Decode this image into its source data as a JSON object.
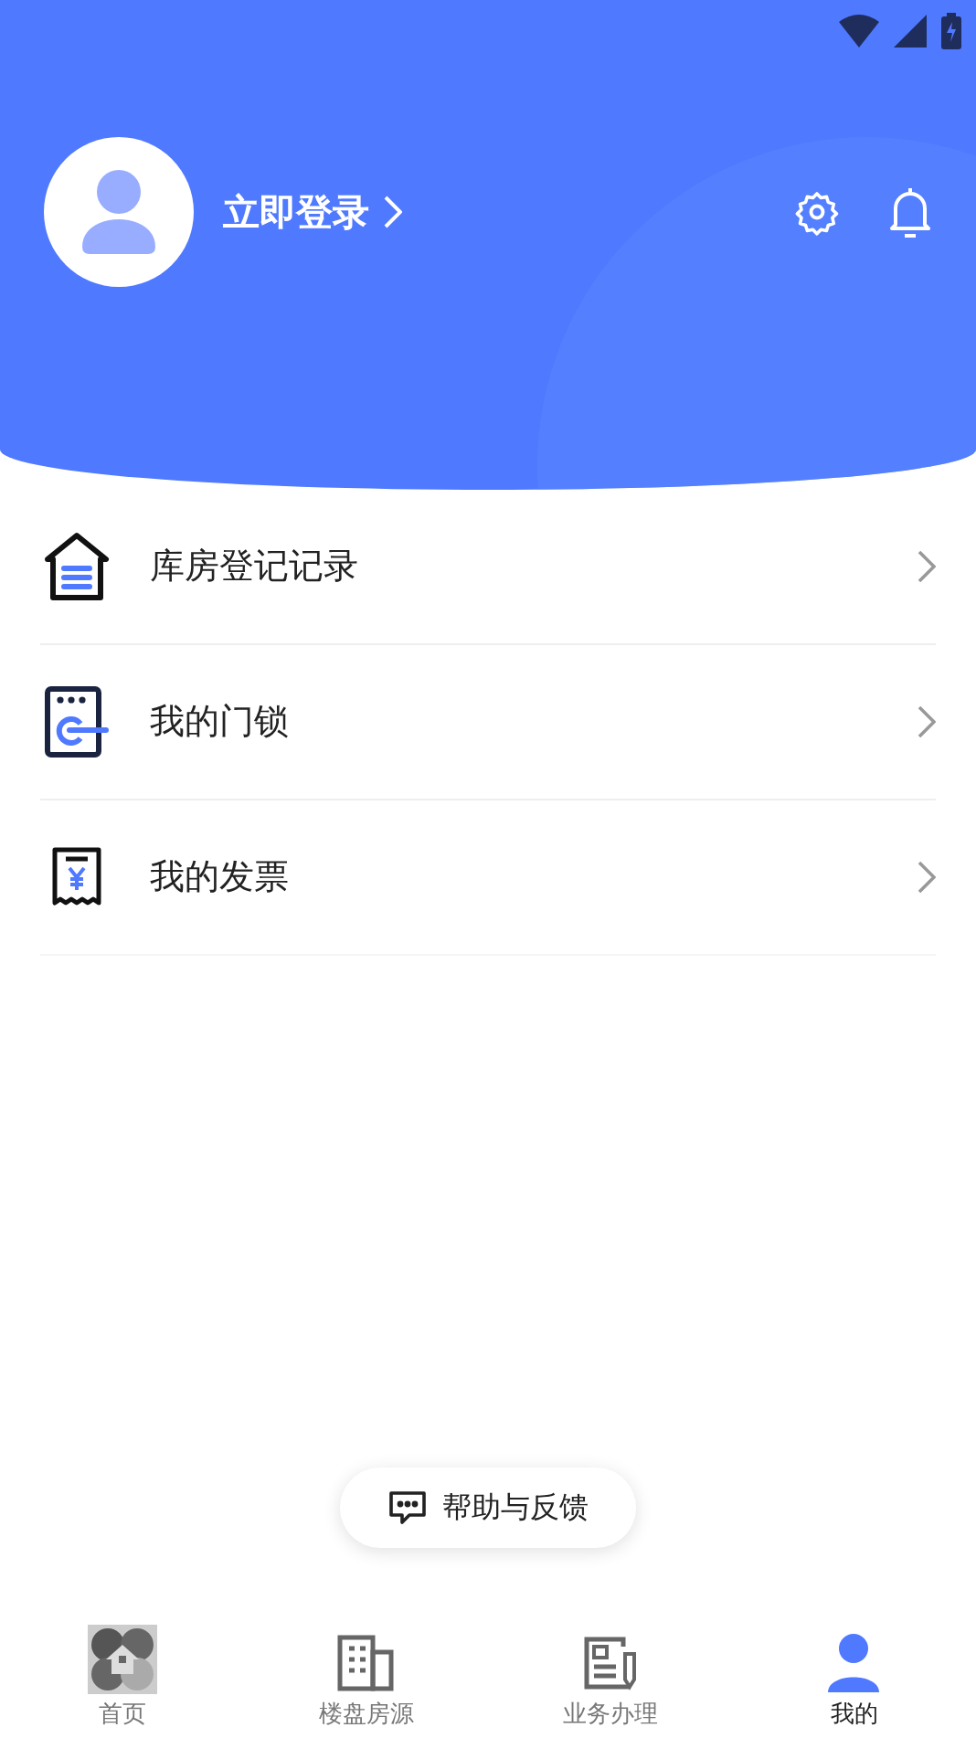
{
  "profile": {
    "login_label": "立即登录"
  },
  "menu": [
    {
      "kind": "warehouse",
      "label": "库房登记记录"
    },
    {
      "kind": "lock",
      "label": "我的门锁"
    },
    {
      "kind": "invoice",
      "label": "我的发票"
    }
  ],
  "help_button": {
    "label": "帮助与反馈"
  },
  "tabs": [
    {
      "kind": "home",
      "label": "首页",
      "selected": false
    },
    {
      "kind": "building",
      "label": "楼盘房源",
      "selected": false
    },
    {
      "kind": "business",
      "label": "业务办理",
      "selected": false
    },
    {
      "kind": "mine",
      "label": "我的",
      "selected": true
    }
  ]
}
